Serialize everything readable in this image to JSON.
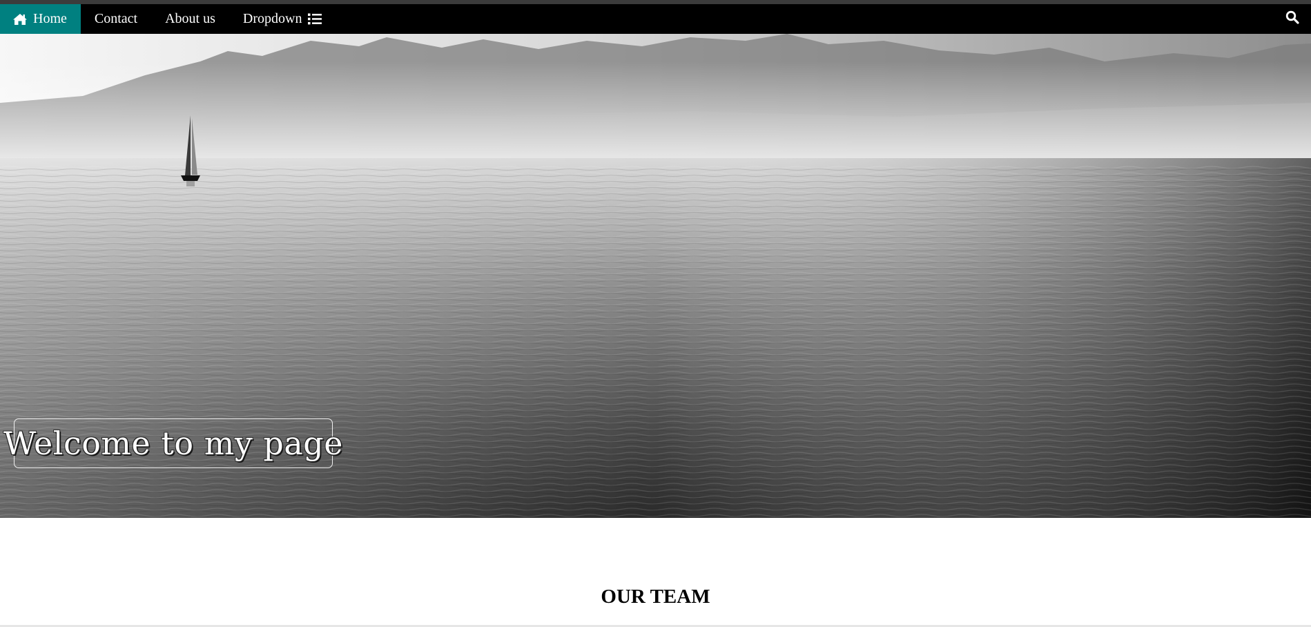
{
  "nav": {
    "items": [
      {
        "label": "Home",
        "icon": "home-icon",
        "active": true
      },
      {
        "label": "Contact"
      },
      {
        "label": "About us"
      },
      {
        "label": "Dropdown",
        "icon": "list-icon"
      }
    ],
    "search_icon": "search-icon"
  },
  "hero": {
    "title": "Welcome to my page",
    "image": "grayscale sea with sailboat and distant mountains"
  },
  "section": {
    "title": "OUR TEAM"
  },
  "colors": {
    "navbar_bg": "#000000",
    "active_bg": "#008080",
    "text_light": "#ffffff"
  }
}
